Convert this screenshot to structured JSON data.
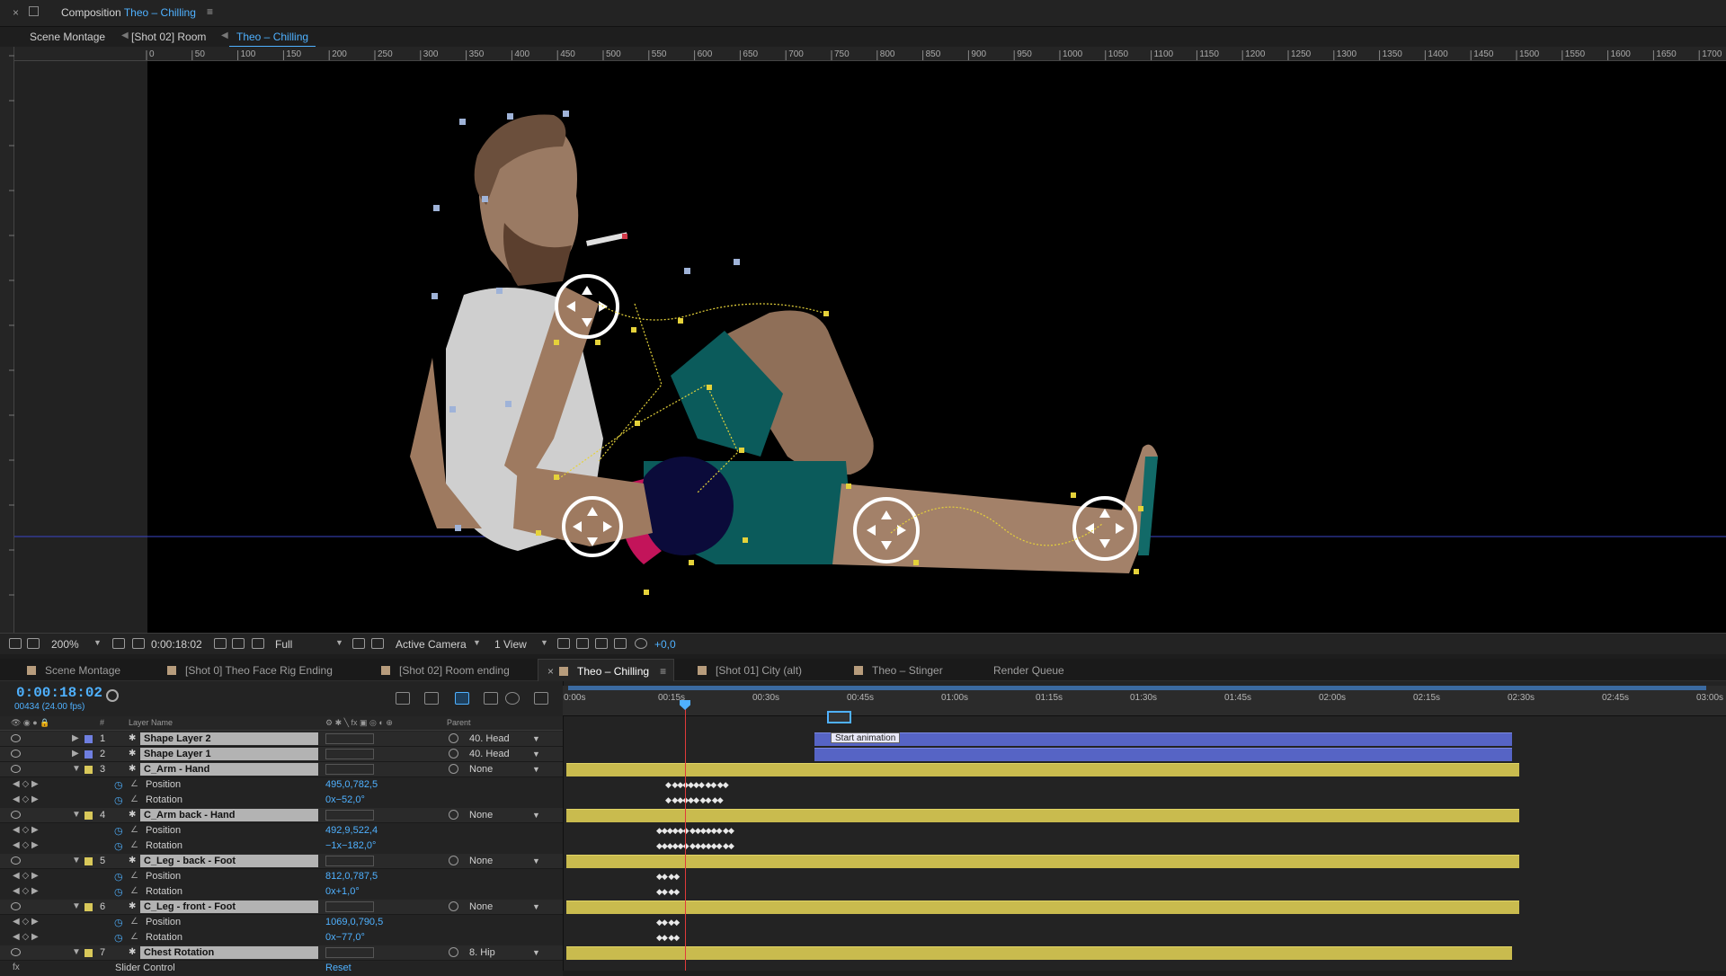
{
  "window": {
    "panel_label": "Composition",
    "comp_name": "Theo – Chilling",
    "close_glyph": "×",
    "menu_glyph": "≡"
  },
  "breadcrumbs": [
    "Scene Montage",
    "[Shot 02] Room",
    "Theo – Chilling"
  ],
  "ruler_labels": [
    "0",
    "50",
    "100",
    "150",
    "200",
    "250",
    "300",
    "350",
    "400",
    "450",
    "500",
    "550",
    "600",
    "650",
    "700",
    "750",
    "800",
    "850",
    "900",
    "950",
    "1000",
    "1050",
    "1100",
    "1150",
    "1200",
    "1250",
    "1300",
    "1350",
    "1400",
    "1450",
    "1500",
    "1550",
    "1600",
    "1650",
    "1700"
  ],
  "viewer_toolbar": {
    "zoom": "200%",
    "timecode": "0:00:18:02",
    "resolution": "Full",
    "camera": "Active Camera",
    "views": "1 View",
    "exposure": "+0,0"
  },
  "tabs": [
    {
      "label": "Scene Montage",
      "color": "#b79c7c",
      "active": false
    },
    {
      "label": "[Shot 0]  Theo Face Rig Ending",
      "color": "#b79c7c",
      "active": false
    },
    {
      "label": "[Shot 02] Room ending",
      "color": "#b79c7c",
      "active": false
    },
    {
      "label": "Theo – Chilling",
      "color": "#b79c7c",
      "active": true
    },
    {
      "label": "[Shot 01] City (alt)",
      "color": "#b79c7c",
      "active": false
    },
    {
      "label": "Theo – Stinger",
      "color": "#b79c7c",
      "active": false
    },
    {
      "label": "Render Queue",
      "color": "",
      "active": false
    }
  ],
  "timeline": {
    "current_time": "0:00:18:02",
    "frame_info": "00434 (24.00 fps)",
    "columns": {
      "layer_name": "Layer Name",
      "parent": "Parent",
      "number": "#"
    },
    "time_labels": [
      "0:00s",
      "00:15s",
      "00:30s",
      "00:45s",
      "01:00s",
      "01:15s",
      "01:30s",
      "01:45s",
      "02:00s",
      "02:15s",
      "02:30s",
      "02:45s",
      "03:00s"
    ],
    "marker_label": "Start animation",
    "layers": [
      {
        "num": "1",
        "name": "Shape Layer 2",
        "label_color": "#6f7fe0",
        "parent": "40. Head",
        "expanded": false,
        "bar": "blue"
      },
      {
        "num": "2",
        "name": "Shape Layer 1",
        "label_color": "#6f7fe0",
        "parent": "40. Head",
        "expanded": false,
        "bar": "blue"
      },
      {
        "num": "3",
        "name": "C_Arm - Hand",
        "label_color": "#d8c85a",
        "parent": "None",
        "expanded": true,
        "bar": "yellow",
        "props": [
          {
            "name": "Position",
            "value": "495,0,782,5"
          },
          {
            "name": "Rotation",
            "value": "0x−52,0°"
          }
        ]
      },
      {
        "num": "4",
        "name": "C_Arm back - Hand",
        "label_color": "#d8c85a",
        "parent": "None",
        "expanded": true,
        "bar": "yellow",
        "props": [
          {
            "name": "Position",
            "value": "492,9,522,4"
          },
          {
            "name": "Rotation",
            "value": "−1x−182,0°"
          }
        ]
      },
      {
        "num": "5",
        "name": "C_Leg - back - Foot",
        "label_color": "#d8c85a",
        "parent": "None",
        "expanded": true,
        "bar": "yellow",
        "props": [
          {
            "name": "Position",
            "value": "812,0,787,5"
          },
          {
            "name": "Rotation",
            "value": "0x+1,0°"
          }
        ]
      },
      {
        "num": "6",
        "name": "C_Leg - front - Foot",
        "label_color": "#d8c85a",
        "parent": "None",
        "expanded": true,
        "bar": "yellow",
        "props": [
          {
            "name": "Position",
            "value": "1069,0,790,5"
          },
          {
            "name": "Rotation",
            "value": "0x−77,0°"
          }
        ]
      },
      {
        "num": "7",
        "name": "Chest Rotation",
        "label_color": "#d8c85a",
        "parent": "8. Hip",
        "expanded": true,
        "bar": "yellow"
      }
    ],
    "effect_row": {
      "name": "Slider Control",
      "value": "Reset"
    }
  }
}
